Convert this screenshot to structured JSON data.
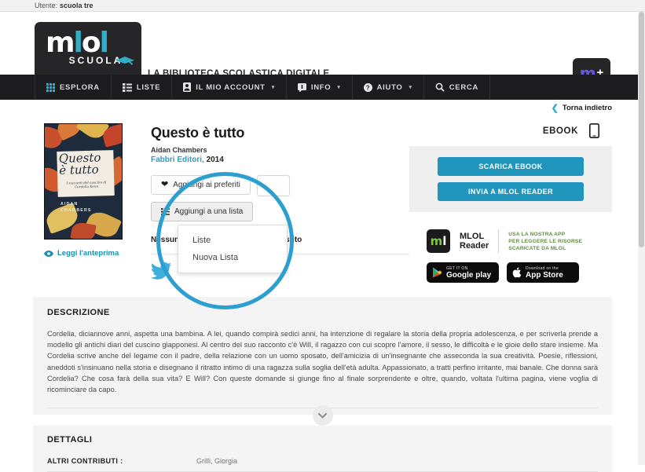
{
  "userbar": {
    "label": "Utente:",
    "user": "scuola tre"
  },
  "header": {
    "logo_main": "mlol",
    "logo_sub": "SCUOLA",
    "tagline": "LA BIBLIOTECA SCOLASTICA DIGITALE",
    "mplus": "m",
    "mplus_sign": "+"
  },
  "nav": {
    "items": [
      {
        "label": "ESPLORA",
        "icon": "grid-icon",
        "caret": "",
        "active": true
      },
      {
        "label": "LISTE",
        "icon": "list-icon",
        "caret": "",
        "active": false
      },
      {
        "label": "IL MIO ACCOUNT",
        "icon": "account-icon",
        "caret": "▾",
        "active": false
      },
      {
        "label": "INFO",
        "icon": "info-icon",
        "caret": "▾",
        "active": false
      },
      {
        "label": "AIUTO",
        "icon": "help-icon",
        "caret": "▾",
        "active": false
      },
      {
        "label": "CERCA",
        "icon": "search-icon",
        "caret": "",
        "active": false
      }
    ]
  },
  "back_link": {
    "chevron": "❮",
    "label": "Torna indietro"
  },
  "book": {
    "title": "Questo è tutto",
    "author": "Aidan Chambers",
    "publisher": "Fabbri Editori",
    "year": "2014",
    "preview_label": "Leggi l'anteprima",
    "cover": {
      "title": "Questo\nè tutto",
      "subtitle": "I racconti del cuscino di Cordelia Kenn",
      "author": "AIDAN\nCHAMBERS"
    },
    "favorite_button": "Aggiungi ai preferiti",
    "list_button": "Aggiungi a una lista",
    "availability": "Nessuna copia disponibile per il prestito"
  },
  "dropdown": {
    "items": [
      "Liste",
      "Nuova Lista"
    ]
  },
  "sidebar": {
    "format_label": "EBOOK",
    "format_icon": "tablet-icon",
    "download_button": "SCARICA EBOOK",
    "send_button": "INVIA A MLOL READER",
    "promo": {
      "brand_line1": "MLOL",
      "brand_line2": "Reader",
      "text": "USA LA NOSTRA APP\nPER LEGGERE LE RISORSE\nSCARICATE DA MLOL",
      "google_small": "GET IT ON",
      "google_big": "Google play",
      "apple_small": "Download on the",
      "apple_big": "App Store"
    }
  },
  "description": {
    "heading": "DESCRIZIONE",
    "text": "Cordelia, diciannove anni, aspetta una bambina. A lei, quando compirà sedici anni, ha intenzione di regalare la storia della propria adolescenza, e per scriverla prende a modello gli antichi diari del cuscino giapponesi. Al centro del suo racconto c'è Will, il ragazzo con cui scopre l'amore, il sesso, le difficoltà e le gioie dello stare insieme. Ma Cordelia scrive anche del legame con il padre, della relazione con un uomo sposato, dell'amicizia di un'insegnante che asseconda la sua creatività. Poesie, riflessioni, aneddoti s'insinuano nella storia e disegnano il ritratto intimo di una ragazza sulla soglia dell'età adulta. Appassionato, a tratti perfino irritante, mai banale. Che donna sarà Cordelia? Che cosa farà della sua vita? E Will? Con queste domande si giunge fino al finale sorprendente e oltre, quando, voltata l'ultima pagina, viene voglia di ricominciare da capo.",
    "expand_icon": "chevron-down-icon"
  },
  "details": {
    "heading": "DETTAGLI",
    "rows": [
      {
        "key": "ALTRI CONTRIBUTI :",
        "value": "Grilli, Giorgia"
      }
    ]
  },
  "colors": {
    "accent_cyan": "#2eb0cc",
    "button_blue": "#2196bd",
    "nav_dark": "#1c1c1f",
    "annotation": "#2a9fd0",
    "twitter": "#3eaedd"
  }
}
